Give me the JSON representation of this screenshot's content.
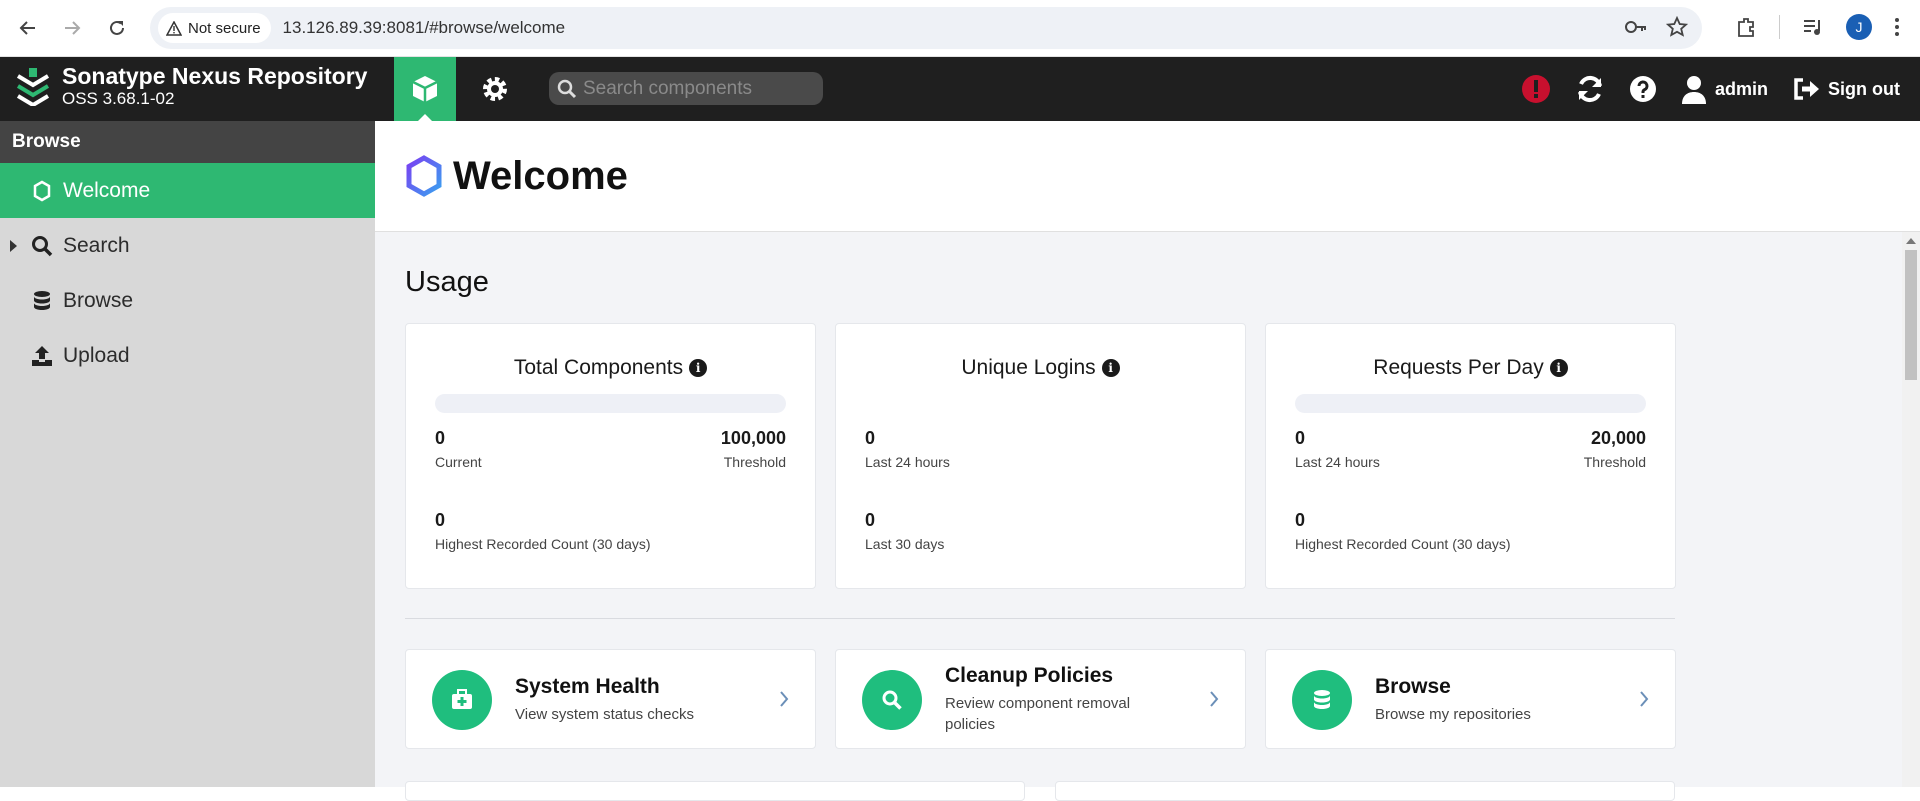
{
  "browser": {
    "security_label": "Not secure",
    "url": "13.126.89.39:8081/#browse/welcome",
    "profile_initial": "J"
  },
  "header": {
    "brand_title": "Sonatype Nexus Repository",
    "brand_version": "OSS 3.68.1-02",
    "search_placeholder": "Search components",
    "user_label": "admin",
    "signout_label": "Sign out",
    "accent_color": "#2eb872",
    "alert_color": "#c8102e"
  },
  "sidebar": {
    "heading": "Browse",
    "items": [
      {
        "label": "Welcome",
        "icon": "hexagon-icon",
        "active": true
      },
      {
        "label": "Search",
        "icon": "search-icon",
        "expandable": true
      },
      {
        "label": "Browse",
        "icon": "database-icon"
      },
      {
        "label": "Upload",
        "icon": "upload-icon"
      }
    ]
  },
  "main": {
    "page_title": "Welcome",
    "usage_heading": "Usage",
    "usage_cards": [
      {
        "title": "Total Components",
        "progress_fraction": 0,
        "current_value": "0",
        "current_label": "Current",
        "threshold_value": "100,000",
        "threshold_label": "Threshold",
        "secondary_value": "0",
        "secondary_label": "Highest Recorded Count (30 days)"
      },
      {
        "title": "Unique Logins",
        "current_value": "0",
        "current_label": "Last 24 hours",
        "secondary_value": "0",
        "secondary_label": "Last 30 days"
      },
      {
        "title": "Requests Per Day",
        "progress_fraction": 0,
        "current_value": "0",
        "current_label": "Last 24 hours",
        "threshold_value": "20,000",
        "threshold_label": "Threshold",
        "secondary_value": "0",
        "secondary_label": "Highest Recorded Count (30 days)"
      }
    ],
    "action_cards": [
      {
        "title": "System Health",
        "subtitle": "View system status checks",
        "icon": "first-aid-kit-icon"
      },
      {
        "title": "Cleanup Policies",
        "subtitle": "Review component removal policies",
        "icon": "search-icon"
      },
      {
        "title": "Browse",
        "subtitle": "Browse my repositories",
        "icon": "database-icon"
      }
    ]
  }
}
